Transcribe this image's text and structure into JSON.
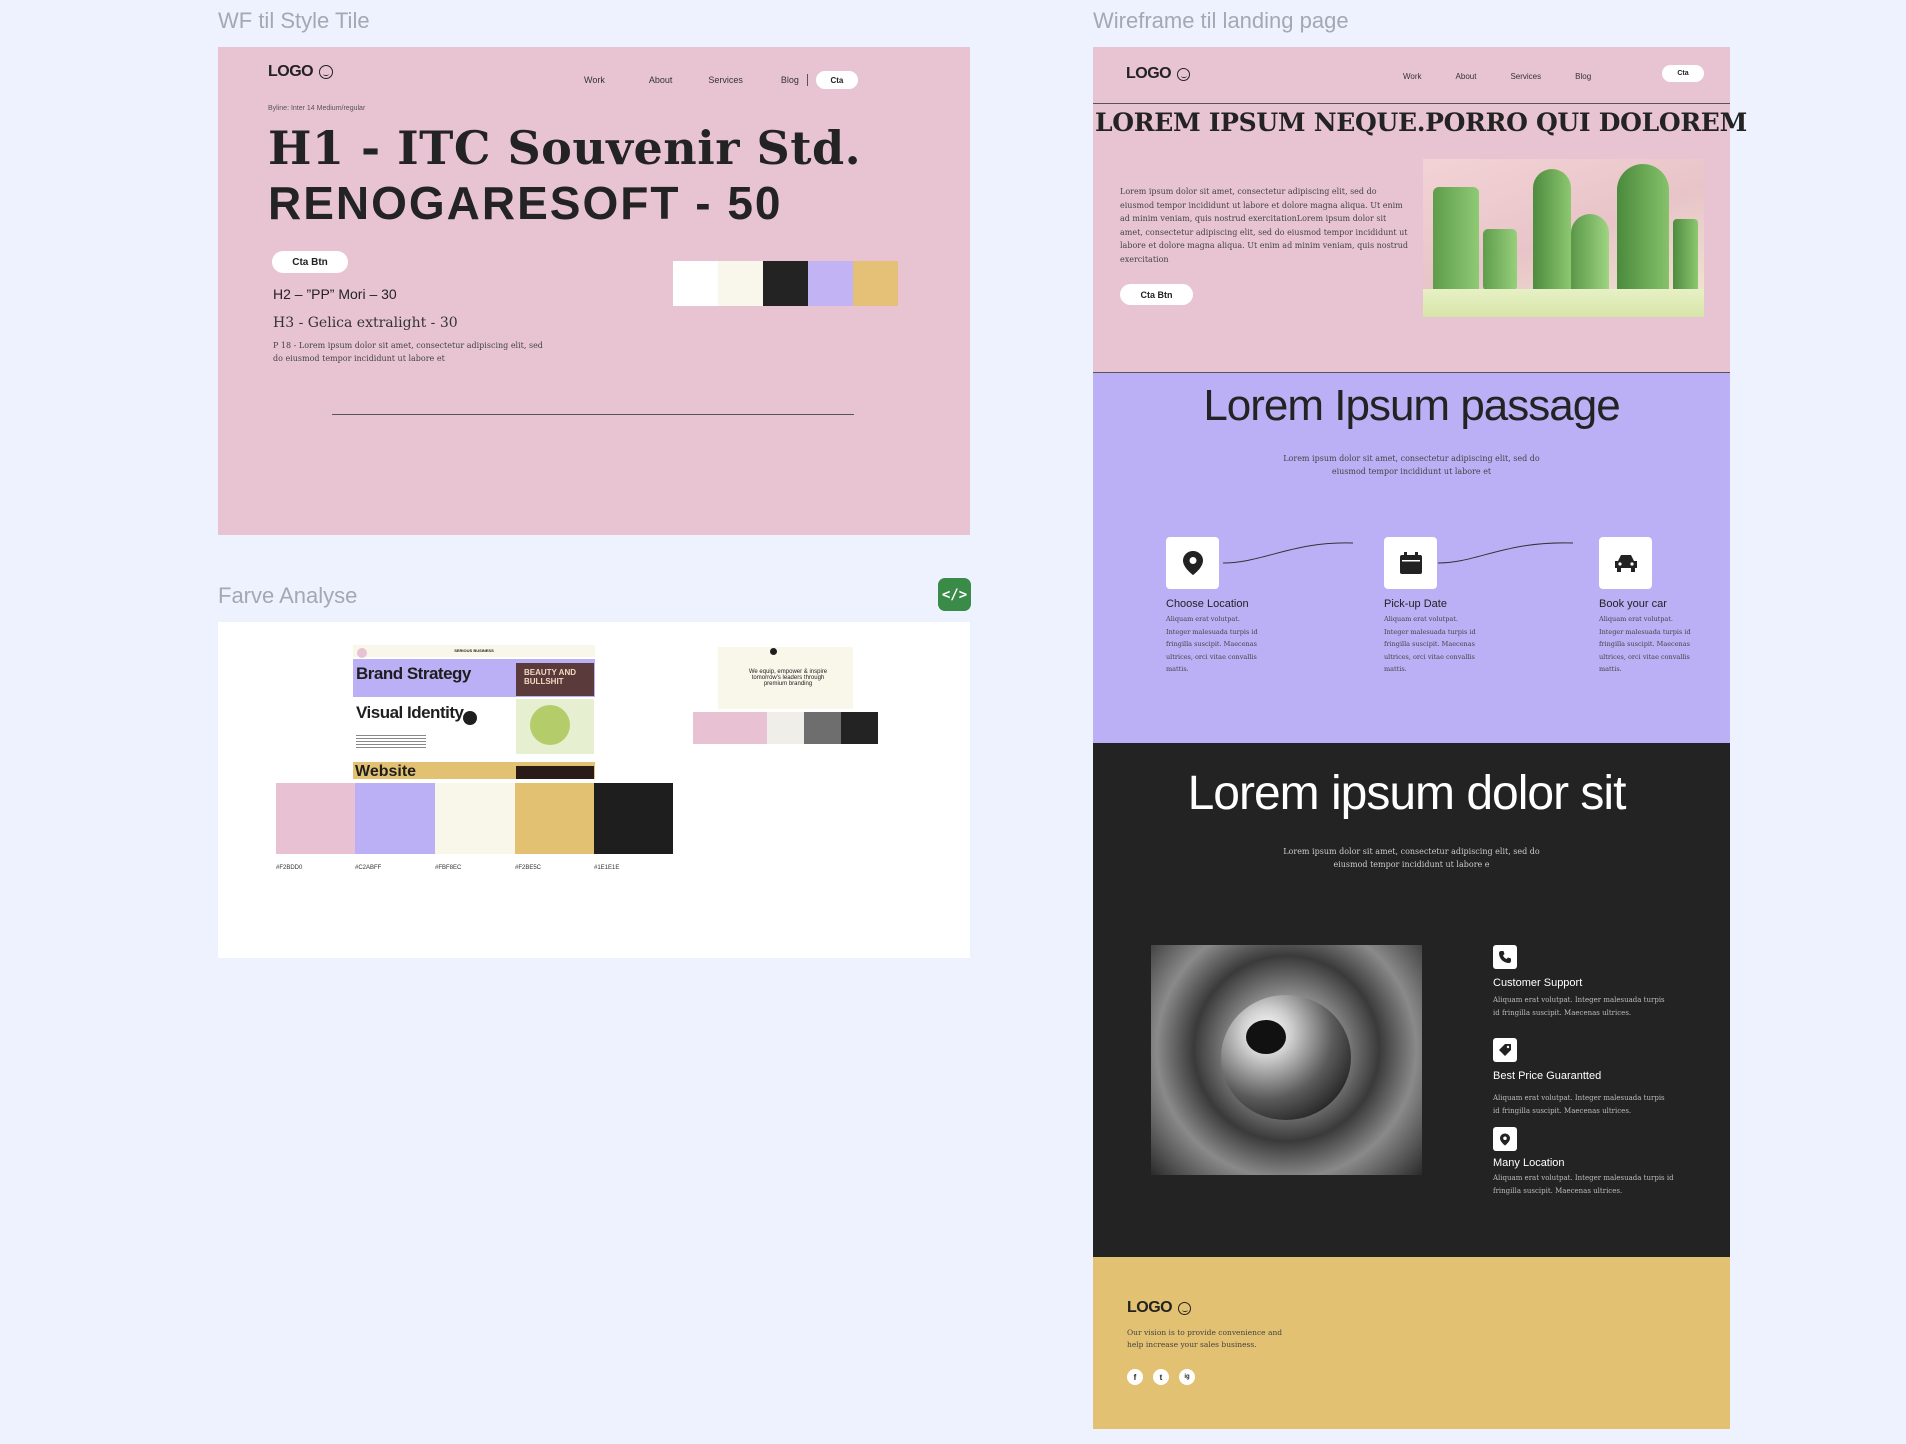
{
  "frames": {
    "style_tile_label": "WF til Style Tile",
    "landing_label": "Wireframe til landing page",
    "color_label": "Farve Analyse"
  },
  "style_tile": {
    "logo": "LOGO",
    "nav": [
      "Work",
      "About",
      "Services",
      "Blog"
    ],
    "nav_cta": "Cta",
    "byline": "Byline: Inter 14 Medium/regular",
    "h1_line1": "H1  - ITC Souvenir Std.",
    "h1_line2": "RENOGARESOFT - 50",
    "cta_button": "Cta Btn",
    "h2": "H2 – ”PP” Mori – 30",
    "h3": "H3 - Gelica extralight - 30",
    "p_line1": "P 18 - Lorem ipsum dolor sit amet, consectetur adipiscing elit, sed",
    "p_line2": "do eiusmod tempor incididunt ut labore et",
    "swatches": [
      "#ffffff",
      "#f9f6ec",
      "#232323",
      "#c2b3f5",
      "#e4c177"
    ]
  },
  "color_analysis": {
    "code_icon": "</>",
    "moodboard": {
      "brand_strategy": "Brand Strategy",
      "visual_identity": "Visual Identity",
      "website": "Website",
      "header_text": "SERIOUS BUSINESS",
      "poster_text": "BEAUTY AND BULLSHIT"
    },
    "second_mock_text": "We equip, empower & inspire tomorrow's leaders through premium branding",
    "palette": [
      {
        "hex": "#F2BDD0",
        "color": "#e8c2d3"
      },
      {
        "hex": "#C2ABFF",
        "color": "#bbb0f5"
      },
      {
        "hex": "#FBF8EC",
        "color": "#f9f6ea"
      },
      {
        "hex": "#F2BE5C",
        "color": "#e3c172"
      },
      {
        "hex": "#1E1E1E",
        "color": "#1e1e1e"
      }
    ],
    "mini_palette": [
      "#e8c2d3",
      "#e8c2d3",
      "#f0eee8",
      "#6e6e6e",
      "#232323"
    ]
  },
  "landing": {
    "logo": "LOGO",
    "nav": [
      "Work",
      "About",
      "Services",
      "Blog"
    ],
    "nav_cta": "Cta",
    "hero_title": "LOREM IPSUM NEQUE.PORRO QUI DOLOREM",
    "hero_text": "Lorem ipsum dolor sit amet, consectetur adipiscing elit, sed do eiusmod tempor incididunt ut labore et dolore magna aliqua. Ut enim ad minim veniam, quis nostrud exercitationLorem ipsum dolor sit amet, consectetur adipiscing elit, sed do eiusmod tempor incididunt ut labore et dolore magna aliqua. Ut enim ad minim veniam, quis nostrud exercitation",
    "hero_cta": "Cta Btn",
    "passage_title": "Lorem Ipsum passage",
    "passage_text_1": "Lorem ipsum dolor sit amet, consectetur adipiscing elit, sed do",
    "passage_text_2": "eiusmod tempor incididunt ut labore et",
    "steps": [
      {
        "icon": "location-pin-icon",
        "title": "Choose Location",
        "text": "Aliquam erat volutpat. Integer malesuada turpis id fringilla suscipit. Maecenas ultrices, orci vitae convallis mattis."
      },
      {
        "icon": "calendar-icon",
        "title": "Pick-up Date",
        "text": "Aliquam erat volutpat. Integer malesuada turpis id fringilla suscipit. Maecenas ultrices, orci vitae convallis mattis."
      },
      {
        "icon": "car-icon",
        "title": "Book your car",
        "text": "Aliquam erat volutpat. Integer malesuada turpis id fringilla suscipit. Maecenas ultrices, orci vitae convallis mattis."
      }
    ],
    "dark_title": "Lorem ipsum dolor sit",
    "dark_text_1": "Lorem ipsum dolor sit amet, consectetur adipiscing elit, sed do",
    "dark_text_2": "eiusmod tempor incididunt ut labore e",
    "features": [
      {
        "icon": "phone-icon",
        "title": "Customer Support",
        "text_1": "Aliquam erat volutpat. Integer malesuada turpis",
        "text_2": "id fringilla suscipit. Maecenas ultrices."
      },
      {
        "icon": "tag-icon",
        "title": "Best Price Guarantted",
        "text_1": "Aliquam erat volutpat. Integer malesuada turpis",
        "text_2": "id fringilla suscipit. Maecenas ultrices."
      },
      {
        "icon": "location-pin-icon",
        "title": "Many Location",
        "text_1": "Aliquam erat volutpat. Integer malesuada turpis id",
        "text_2": "fringilla suscipit. Maecenas ultrices."
      }
    ],
    "footer_logo": "LOGO",
    "footer_text_1": "Our vision is to provide convenience and",
    "footer_text_2": "help increase your sales business.",
    "social": [
      "f",
      "t",
      "ig"
    ]
  }
}
